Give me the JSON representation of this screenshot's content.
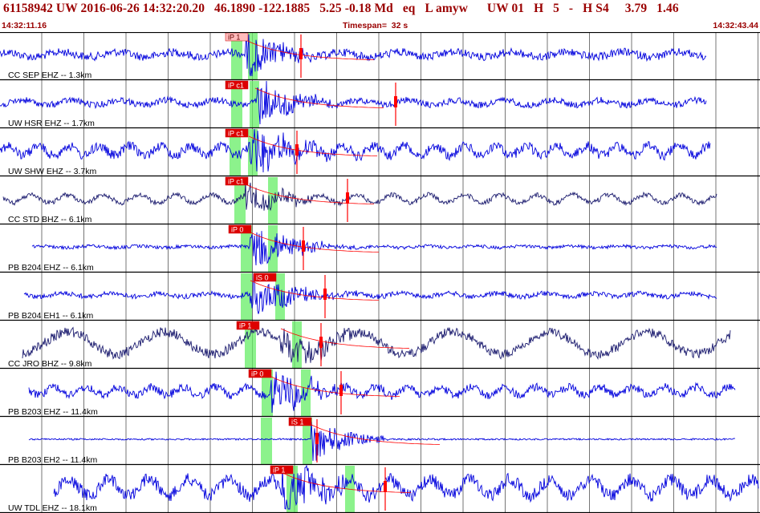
{
  "header": {
    "title": "61158942 UW 2016-06-26 14:32:20.20   46.1890 -122.1885   5.25 -0.18 Md   eq   L amyw      UW 01   H   5   -   H S4     3.79   1.46",
    "start_time": "14:32:11.16",
    "timespan": "Timespan=  32 s",
    "end_time": "14:32:43.44"
  },
  "colors": {
    "header_text": "#9a0000",
    "trace_default": "#0000dd",
    "trace_dark": "#1a1a6e",
    "pick": "#ff0000",
    "pick_window": "#66ee66",
    "grid": "#000000"
  },
  "channels": [
    {
      "label": "CC SEP EHZ -- 1.3km",
      "phase": "iP 1",
      "color": "#0000dd"
    },
    {
      "label": "UW HSR EHZ -- 1.7km",
      "phase": "iP c1",
      "color": "#0000dd"
    },
    {
      "label": "UW SHW EHZ -- 3.7km",
      "phase": "iP c1",
      "color": "#0000dd"
    },
    {
      "label": "CC STD BHZ -- 6.1km",
      "phase": "iP c1",
      "color": "#1a1a6e"
    },
    {
      "label": "PB B204 EHZ -- 6.1km",
      "phase": "iP 0",
      "color": "#0000dd"
    },
    {
      "label": "PB B204 EH1 -- 6.1km",
      "phase": "iS 0",
      "color": "#0000dd"
    },
    {
      "label": "CC JRO BHZ -- 9.8km",
      "phase": "iP 1",
      "color": "#1a1a6e"
    },
    {
      "label": "PB B203 EHZ -- 11.4km",
      "phase": "iP 0",
      "color": "#0000dd"
    },
    {
      "label": "PB B203 EH2 -- 11.4km",
      "phase": "iS 1",
      "color": "#0000dd"
    },
    {
      "label": "UW TDL EHZ -- 18.1km",
      "phase": "iP 1",
      "color": "#0000dd"
    }
  ]
}
